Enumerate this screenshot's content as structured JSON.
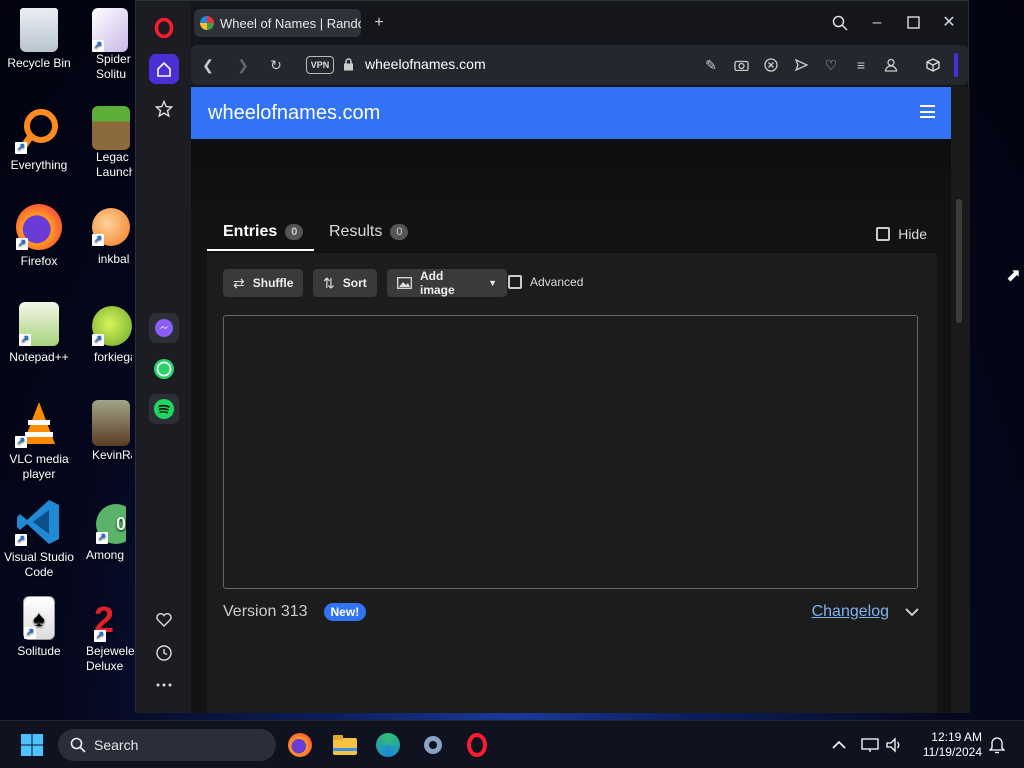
{
  "desktop": {
    "icons": [
      {
        "label": "Recycle Bin"
      },
      {
        "label": "Spider Solitu"
      },
      {
        "label": "Everything"
      },
      {
        "label": "Legac Launch"
      },
      {
        "label": "Firefox"
      },
      {
        "label": "inkbal"
      },
      {
        "label": "Notepad++"
      },
      {
        "label": "forkiega"
      },
      {
        "label": "VLC media player"
      },
      {
        "label": "KevinRac"
      },
      {
        "label": "Visual Studio Code"
      },
      {
        "label": "Among"
      },
      {
        "label": "Solitude"
      },
      {
        "label": "Bejewele Deluxe"
      }
    ]
  },
  "browser": {
    "tab_title": "Wheel of Names | Random",
    "vpn_label": "VPN",
    "url": "wheelofnames.com"
  },
  "page": {
    "site_title": "wheelofnames.com",
    "tabs": [
      {
        "label": "Entries",
        "count": "0"
      },
      {
        "label": "Results",
        "count": "0"
      }
    ],
    "hide_label": "Hide",
    "toolbar": {
      "shuffle_label": "Shuffle",
      "sort_label": "Sort",
      "add_image_label": "Add image",
      "advanced_label": "Advanced"
    },
    "version_text": "Version 313",
    "new_badge": "New!",
    "changelog_label": "Changelog"
  },
  "taskbar": {
    "search_placeholder": "Search",
    "time": "12:19 AM",
    "date": "11/19/2024"
  },
  "colors": {
    "accent": "#3273f5",
    "opera_red": "#ff1b2d"
  }
}
